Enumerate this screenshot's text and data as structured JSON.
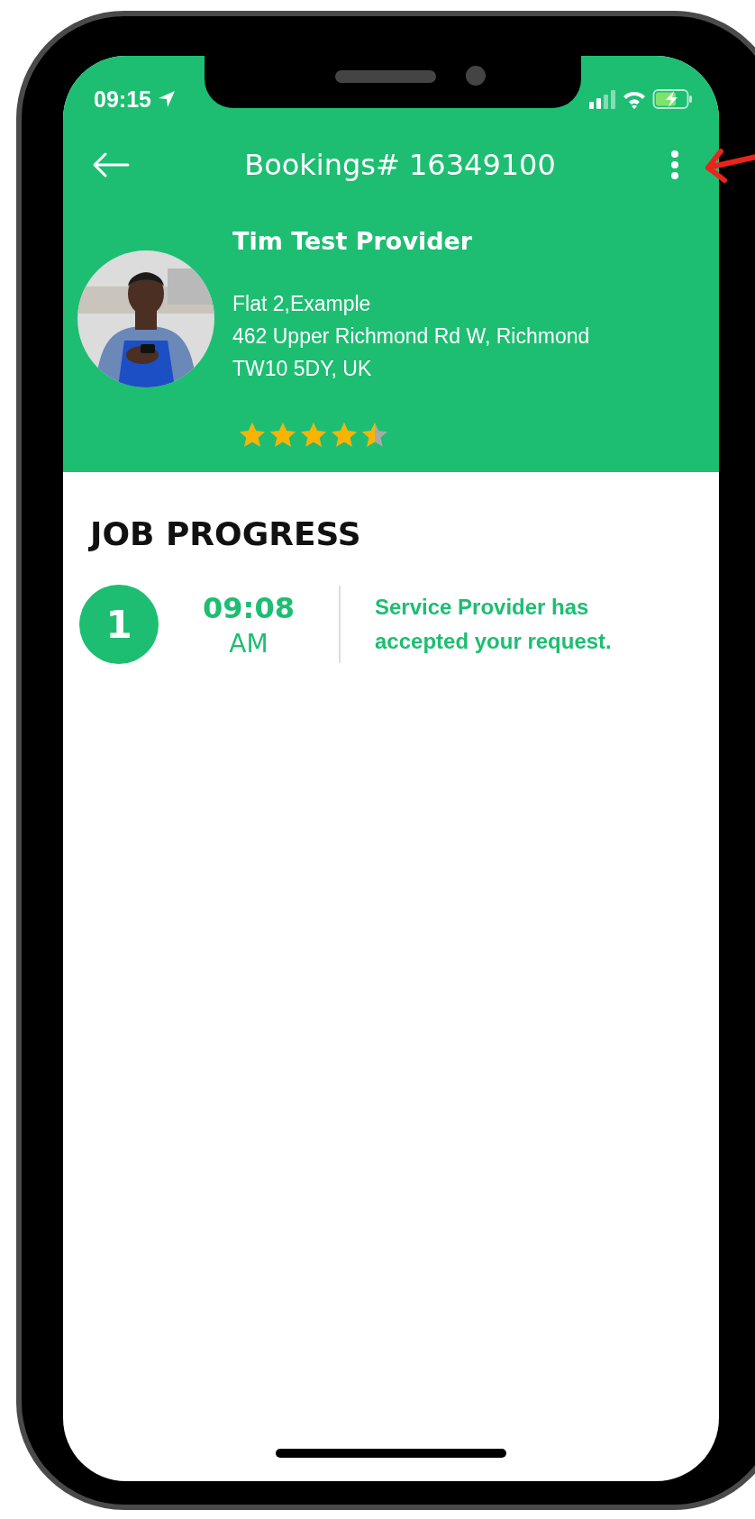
{
  "status_bar": {
    "time": "09:15"
  },
  "header": {
    "title": "Bookings# 16349100"
  },
  "provider": {
    "name": "Tim Test Provider",
    "address": [
      "Flat 2,Example",
      "462 Upper Richmond Rd W,  Richmond",
      "TW10 5DY,  UK"
    ],
    "stars": 4.5
  },
  "job_progress": {
    "title": "JOB PROGRESS",
    "steps": [
      {
        "number": "1",
        "time": "09:08",
        "period": "AM",
        "message": "Service Provider has accepted your request."
      }
    ]
  }
}
